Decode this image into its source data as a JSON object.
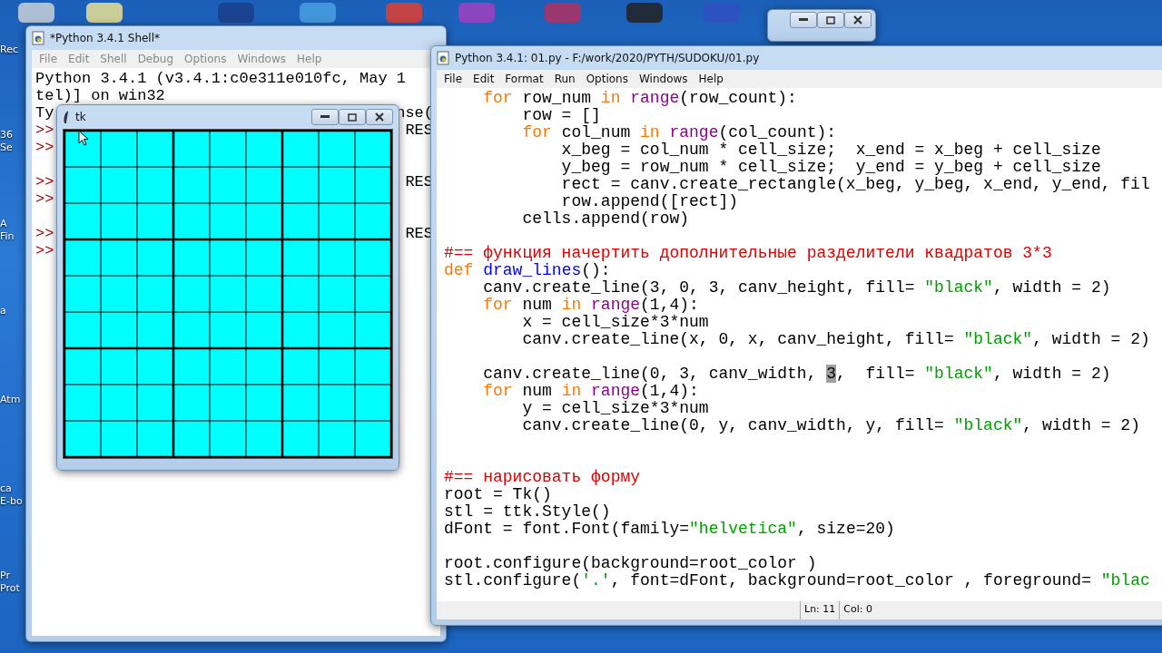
{
  "desktop": {
    "icon_labels": [
      {
        "text": "Rec"
      },
      {
        "text": "36"
      },
      {
        "text": "Se"
      },
      {
        "text": "A"
      },
      {
        "text": "Fin"
      },
      {
        "text": "a"
      },
      {
        "text": "Atm"
      },
      {
        "text": "ca"
      },
      {
        "text": "E-bo"
      },
      {
        "text": "Pr"
      },
      {
        "text": "Prot"
      }
    ]
  },
  "shell": {
    "title": "*Python 3.4.1 Shell*",
    "menu": [
      "File",
      "Edit",
      "Shell",
      "Debug",
      "Options",
      "Windows",
      "Help"
    ],
    "lines": [
      {
        "kind": "text",
        "left": "Python 3.4.1 (v3.4.1:c0e311e010fc, May 1"
      },
      {
        "kind": "text",
        "left": "tel)] on win32"
      },
      {
        "kind": "text",
        "left": "Ty",
        "right": "nse("
      },
      {
        "kind": "prompt",
        "left": ">>",
        "right": "RES"
      },
      {
        "kind": "prompt",
        "left": ">>"
      },
      {
        "kind": "blank"
      },
      {
        "kind": "prompt",
        "left": ">>",
        "right": "RES"
      },
      {
        "kind": "prompt",
        "left": ">>"
      },
      {
        "kind": "blank"
      },
      {
        "kind": "prompt",
        "left": ">>",
        "right": "RES"
      },
      {
        "kind": "prompt",
        "left": ">>"
      }
    ]
  },
  "tk": {
    "title": "tk"
  },
  "editor": {
    "title": "Python 3.4.1: 01.py - F:/work/2020/PYTH/SUDOKU/01.py",
    "menu": [
      "File",
      "Edit",
      "Format",
      "Run",
      "Options",
      "Windows",
      "Help"
    ],
    "lines": [
      {
        "tokens": [
          {
            "kind": "keyword",
            "text": "    for"
          },
          {
            "kind": "plain",
            "text": " row_num "
          },
          {
            "kind": "keyword",
            "text": "in "
          },
          {
            "kind": "builtin",
            "text": "range"
          },
          {
            "kind": "plain",
            "text": "(row_count):"
          }
        ]
      },
      {
        "tokens": [
          {
            "kind": "plain",
            "text": "        row = []"
          }
        ]
      },
      {
        "tokens": [
          {
            "kind": "keyword",
            "text": "        for"
          },
          {
            "kind": "plain",
            "text": " col_num "
          },
          {
            "kind": "keyword",
            "text": "in "
          },
          {
            "kind": "builtin",
            "text": "range"
          },
          {
            "kind": "plain",
            "text": "(col_count):"
          }
        ]
      },
      {
        "tokens": [
          {
            "kind": "plain",
            "text": "            x_beg = col_num * cell_size;  x_end = x_beg + cell_size"
          }
        ]
      },
      {
        "tokens": [
          {
            "kind": "plain",
            "text": "            y_beg = row_num * cell_size;  y_end = y_beg + cell_size"
          }
        ]
      },
      {
        "tokens": [
          {
            "kind": "plain",
            "text": "            rect = canv.create_rectangle(x_beg, y_beg, x_end, y_end, fil"
          }
        ]
      },
      {
        "tokens": [
          {
            "kind": "plain",
            "text": "            row.append([rect])"
          }
        ]
      },
      {
        "tokens": [
          {
            "kind": "plain",
            "text": "        cells.append(row)"
          }
        ]
      },
      {
        "kind": "blank"
      },
      {
        "tokens": [
          {
            "kind": "comment",
            "text": "#== функция начертить дополнительные разделители квадратов 3*3"
          }
        ]
      },
      {
        "tokens": [
          {
            "kind": "keyword",
            "text": "def "
          },
          {
            "kind": "defname",
            "text": "draw_lines"
          },
          {
            "kind": "plain",
            "text": "():"
          }
        ]
      },
      {
        "tokens": [
          {
            "kind": "plain",
            "text": "    canv.create_line(3, 0, 3, canv_height, fill= "
          },
          {
            "kind": "string",
            "text": "\"black\""
          },
          {
            "kind": "plain",
            "text": ", width = 2)"
          }
        ]
      },
      {
        "tokens": [
          {
            "kind": "keyword",
            "text": "    for"
          },
          {
            "kind": "plain",
            "text": " num "
          },
          {
            "kind": "keyword",
            "text": "in "
          },
          {
            "kind": "builtin",
            "text": "range"
          },
          {
            "kind": "plain",
            "text": "(1,4):"
          }
        ]
      },
      {
        "tokens": [
          {
            "kind": "plain",
            "text": "        x = cell_size*3*num"
          }
        ]
      },
      {
        "tokens": [
          {
            "kind": "plain",
            "text": "        canv.create_line(x, 0, x, canv_height, fill= "
          },
          {
            "kind": "string",
            "text": "\"black\""
          },
          {
            "kind": "plain",
            "text": ", width = 2)"
          }
        ]
      },
      {
        "kind": "blank"
      },
      {
        "tokens": [
          {
            "kind": "plain",
            "text": "    canv.create_line(0, 3, canv_width, "
          },
          {
            "kind": "selection",
            "text": "3"
          },
          {
            "kind": "plain",
            "text": ",  fill= "
          },
          {
            "kind": "string",
            "text": "\"black\""
          },
          {
            "kind": "plain",
            "text": ", width = 2)"
          }
        ]
      },
      {
        "tokens": [
          {
            "kind": "keyword",
            "text": "    for"
          },
          {
            "kind": "plain",
            "text": " num "
          },
          {
            "kind": "keyword",
            "text": "in "
          },
          {
            "kind": "builtin",
            "text": "range"
          },
          {
            "kind": "plain",
            "text": "(1,4):"
          }
        ]
      },
      {
        "tokens": [
          {
            "kind": "plain",
            "text": "        y = cell_size*3*num"
          }
        ]
      },
      {
        "tokens": [
          {
            "kind": "plain",
            "text": "        canv.create_line(0, y, canv_width, y, fill= "
          },
          {
            "kind": "string",
            "text": "\"black\""
          },
          {
            "kind": "plain",
            "text": ", width = 2)"
          }
        ]
      },
      {
        "kind": "blank"
      },
      {
        "kind": "blank"
      },
      {
        "tokens": [
          {
            "kind": "comment",
            "text": "#== нарисовать форму"
          }
        ]
      },
      {
        "tokens": [
          {
            "kind": "plain",
            "text": "root = Tk()"
          }
        ]
      },
      {
        "tokens": [
          {
            "kind": "plain",
            "text": "stl = ttk.Style()"
          }
        ]
      },
      {
        "tokens": [
          {
            "kind": "plain",
            "text": "dFont = font.Font(family="
          },
          {
            "kind": "string",
            "text": "\"helvetica\""
          },
          {
            "kind": "plain",
            "text": ", size=20)"
          }
        ]
      },
      {
        "kind": "blank"
      },
      {
        "tokens": [
          {
            "kind": "plain",
            "text": "root.configure(background=root_color )"
          }
        ]
      },
      {
        "tokens": [
          {
            "kind": "plain",
            "text": "stl.configure("
          },
          {
            "kind": "string",
            "text": "'.'"
          },
          {
            "kind": "plain",
            "text": ", font=dFont, background=root_color , foreground= "
          },
          {
            "kind": "string",
            "text": "\"blac"
          }
        ]
      }
    ],
    "status": [
      "Ln: 11",
      "Col: 0"
    ]
  }
}
